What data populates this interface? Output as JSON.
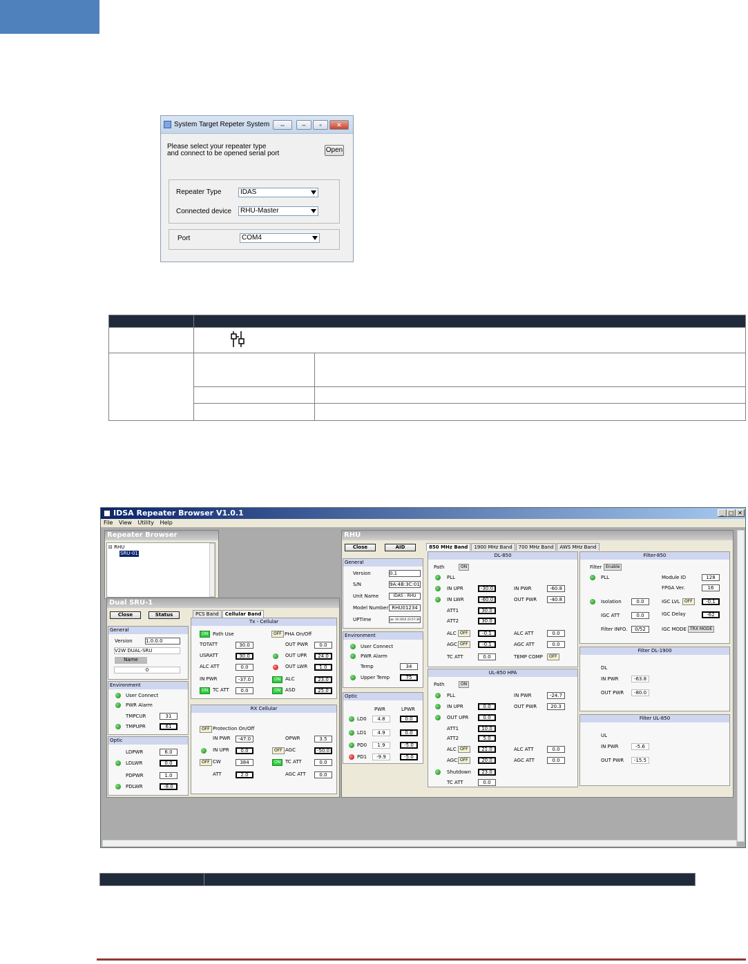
{
  "dialog": {
    "title": "System Target Repeter System",
    "prompt_line1": "Please select your repeater type",
    "prompt_line2": "and connect to be opened serial port",
    "open_label": "Open",
    "repeater_type_label": "Repeater Type",
    "repeater_type_value": "IDAS",
    "connected_device_label": "Connected device",
    "connected_device_value": "RHU-Master",
    "port_label": "Port",
    "port_value": "COM4"
  },
  "app": {
    "title": "IDSA Repeater Browser V1.0.1",
    "menu": [
      "File",
      "View",
      "Utility",
      "Help"
    ],
    "browser": {
      "header": "Repeater Browser",
      "tree_root": "RHU",
      "tree_child": "SRU-01"
    },
    "sru": {
      "header": "Dual SRU-1",
      "close": "Close",
      "status": "Status",
      "general": "General",
      "version_label": "Version",
      "version": "1.0.0.0",
      "model": "V2W DUAL-SRU",
      "name_label": "Name",
      "name_value": "0",
      "env": "Environment",
      "user_connect": "User Connect",
      "pwr_alarm": "PWR Alarm",
      "tmpcur_label": "TMPCUR",
      "tmpcur": "31",
      "tmpupr_label": "TMPUPR",
      "tmpupr": "61",
      "optic": "Optic",
      "ldpwr_label": "LDPWR",
      "ldpwr": "6.0",
      "ldlwr_label": "LDLWR",
      "ldlwr": "0.0",
      "pdpwr_label": "PDPWR",
      "pdpwr": "1.0",
      "pdlwr_label": "PDLWR",
      "pdlwr": "-8.0",
      "tab_pcs": "PCS Band",
      "tab_cell": "Cellular Band",
      "tx": "Tx - Cellular",
      "on": "ON",
      "off": "OFF",
      "path_use": "Path Use",
      "pha": "PHA On/Off",
      "totatt_label": "TOTATT",
      "totatt": "30.0",
      "out_pwr_label": "OUT PWR",
      "out_pwr": "0.0",
      "usratt_label": "USRATT",
      "usratt": "30.0",
      "out_upr_label": "OUT UPR",
      "out_upr": "24.0",
      "alcatt_label": "ALC ATT",
      "alcatt": "0.0",
      "out_lwr_label": "OUT LWR",
      "out_lwr": "1.0",
      "in_pwr_label": "IN PWR",
      "in_pwr": "-37.0",
      "alc_label": "ALC",
      "alc": "23.0",
      "tc_att_label": "TC ATT",
      "tc_att": "0.0",
      "asd_label": "ASD",
      "asd": "25.0",
      "rx": "RX Cellular",
      "protection": "Protection On/Off",
      "rx_in_pwr": "-47.0",
      "opwr_label": "OPWR",
      "opwr": "3.5",
      "in_upr_label": "IN UPR",
      "rx_in_upr": "0.0",
      "agc_label": "AGC",
      "agc": "-50.0",
      "cw_label": "CW",
      "cw": "384",
      "rx_tc_att": "0.0",
      "att_label": "ATT",
      "att": "2.0",
      "agc_att_label": "AGC ATT",
      "agc_att": "0.0"
    },
    "rhu": {
      "header": "RHU",
      "close": "Close",
      "aid": "AID",
      "general": "General",
      "version_label": "Version",
      "version": "0.1",
      "sn_label": "S/N",
      "sn": "9A:4B:3C:01",
      "unit_label": "Unit Name",
      "unit": "IDAS : RHU",
      "model_label": "Model Number",
      "model": "RHU01234",
      "uptime_label": "UPTime",
      "uptime": "Jan 19 2016 23:57:30",
      "env": "Environment",
      "user_connect": "User Connect",
      "pwr_alarm": "PWR Alarm",
      "temp_label": "Temp",
      "temp": "34",
      "upper_label": "Upper Temp",
      "upper": "75",
      "optic": "Optic",
      "pwr_col": "PWR",
      "lpwr_col": "LPWR",
      "ld0": "LD0",
      "ld0_p": "4.8",
      "ld0_l": "0.0",
      "ld1": "LD1",
      "ld1_p": "4.9",
      "ld1_l": "0.0",
      "pd0": "PD0",
      "pd0_p": "1.9",
      "pd0_l": "-5.0",
      "pd1": "PD1",
      "pd1_p": "-9.9",
      "pd1_l": "-5.0"
    },
    "bands": {
      "tabs": [
        "850 MHz Band",
        "1900 MHz Band",
        "700 MHz Band",
        "AWS MHz Band"
      ],
      "dl": "DL-850",
      "path": "Path",
      "on": "ON",
      "off": "OFF",
      "pll": "PLL",
      "in_upr": "IN UPR",
      "in_lwr": "IN LWR",
      "in_pwr": "IN PWR",
      "out_pwr": "OUT PWR",
      "att1": "ATT1",
      "att2": "ATT2",
      "alc": "ALC",
      "agc": "AGC",
      "alc_att": "ALC ATT",
      "agc_att": "AGC ATT",
      "tc_att": "TC ATT",
      "temp_comp": "TEMP COMP",
      "dl_in_upr": "-30.0",
      "dl_in_lwr": "-60.0",
      "dl_in_pwr": "-60.8",
      "dl_out_pwr": "-40.8",
      "dl_att1": "30.0",
      "dl_att2": "30.0",
      "dl_alc": "-0.1",
      "dl_agc": "-0.1",
      "dl_alc_att": "0.0",
      "dl_agc_att": "0.0",
      "dl_tc_att": "0.0",
      "ul": "UL-850 HPA",
      "out_upr": "OUT UPR",
      "shutdown": "Shutdown",
      "ul_in_upr": "0.0",
      "ul_out_upr": "0.0",
      "ul_att1": "10.0",
      "ul_att2": "5.0",
      "ul_alc": "21.0",
      "ul_agc": "20.0",
      "ul_shutdown": "23.0",
      "ul_tc_att": "0.0",
      "ul_in_pwr": "-24.7",
      "ul_out_pwr": "20.3",
      "ul_alc_att": "0.0",
      "ul_agc_att": "0.0"
    },
    "filter": {
      "head": "Filter-850",
      "filter_label": "Filter",
      "enable": "Enable",
      "module_label": "Module ID",
      "module": "128",
      "fpga_label": "FPGA Ver.",
      "fpga": "16",
      "isolation_label": "Isolation",
      "isolation": "0.0",
      "igc_lvl_label": "IGC LVL",
      "igc_lvl": "-0.1",
      "igc_att_label": "IGC ATT",
      "igc_att": "0.0",
      "igc_delay_label": "IGC Delay",
      "igc_delay": "-62",
      "info_label": "Filter INFO.",
      "info": "0/52",
      "igc_mode_label": "IGC MODE",
      "igc_mode": "TRX MODE",
      "dl1900_head": "Filter DL-1900",
      "dl_label": "DL",
      "in_pwr_label": "IN PWR",
      "out_pwr_label": "OUT PWR",
      "dl1900_in": "-63.8",
      "dl1900_out": "-80.0",
      "ul850_head": "Filter UL-850",
      "ul_label": "UL",
      "ul850_in": "-5.6",
      "ul850_out": "-15.5"
    }
  }
}
